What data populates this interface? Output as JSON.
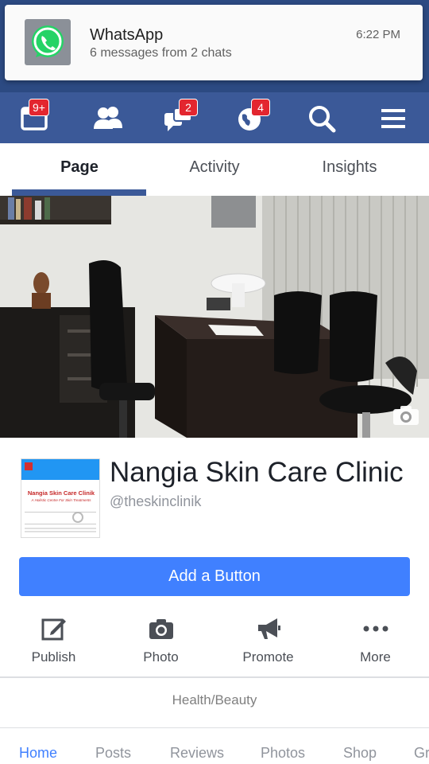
{
  "notification": {
    "app": "WhatsApp",
    "message": "6 messages from 2 chats",
    "time": "6:22 PM",
    "icon": "whatsapp-icon"
  },
  "navbar": {
    "items": [
      {
        "icon": "feed-icon",
        "badge": "9+"
      },
      {
        "icon": "friends-icon",
        "badge": ""
      },
      {
        "icon": "messages-icon",
        "badge": "2"
      },
      {
        "icon": "globe-notifications-icon",
        "badge": "4"
      },
      {
        "icon": "search-icon",
        "badge": ""
      },
      {
        "icon": "menu-icon",
        "badge": ""
      }
    ]
  },
  "tabs": [
    {
      "label": "Page",
      "active": true
    },
    {
      "label": "Activity",
      "active": false
    },
    {
      "label": "Insights",
      "active": false
    }
  ],
  "page": {
    "name": "Nangia Skin Care Clinic",
    "handle": "@theskinclinik",
    "profile_text": "Nangia Skin Care Clinik",
    "profile_tagline": "A Holistic Centre For Skin Treatments",
    "add_button": "Add a Button",
    "category": "Health/Beauty"
  },
  "actions": [
    {
      "label": "Publish",
      "icon": "edit-icon"
    },
    {
      "label": "Photo",
      "icon": "camera-icon"
    },
    {
      "label": "Promote",
      "icon": "megaphone-icon"
    },
    {
      "label": "More",
      "icon": "more-dots-icon"
    }
  ],
  "subnav": [
    {
      "label": "Home",
      "active": true
    },
    {
      "label": "Posts",
      "active": false
    },
    {
      "label": "Reviews",
      "active": false
    },
    {
      "label": "Photos",
      "active": false
    },
    {
      "label": "Shop",
      "active": false
    },
    {
      "label": "Gr",
      "active": false
    }
  ],
  "colors": {
    "fb_blue": "#3b5998",
    "button_blue": "#4080ff",
    "badge_red": "#e3262f",
    "whatsapp_green": "#25d366"
  }
}
